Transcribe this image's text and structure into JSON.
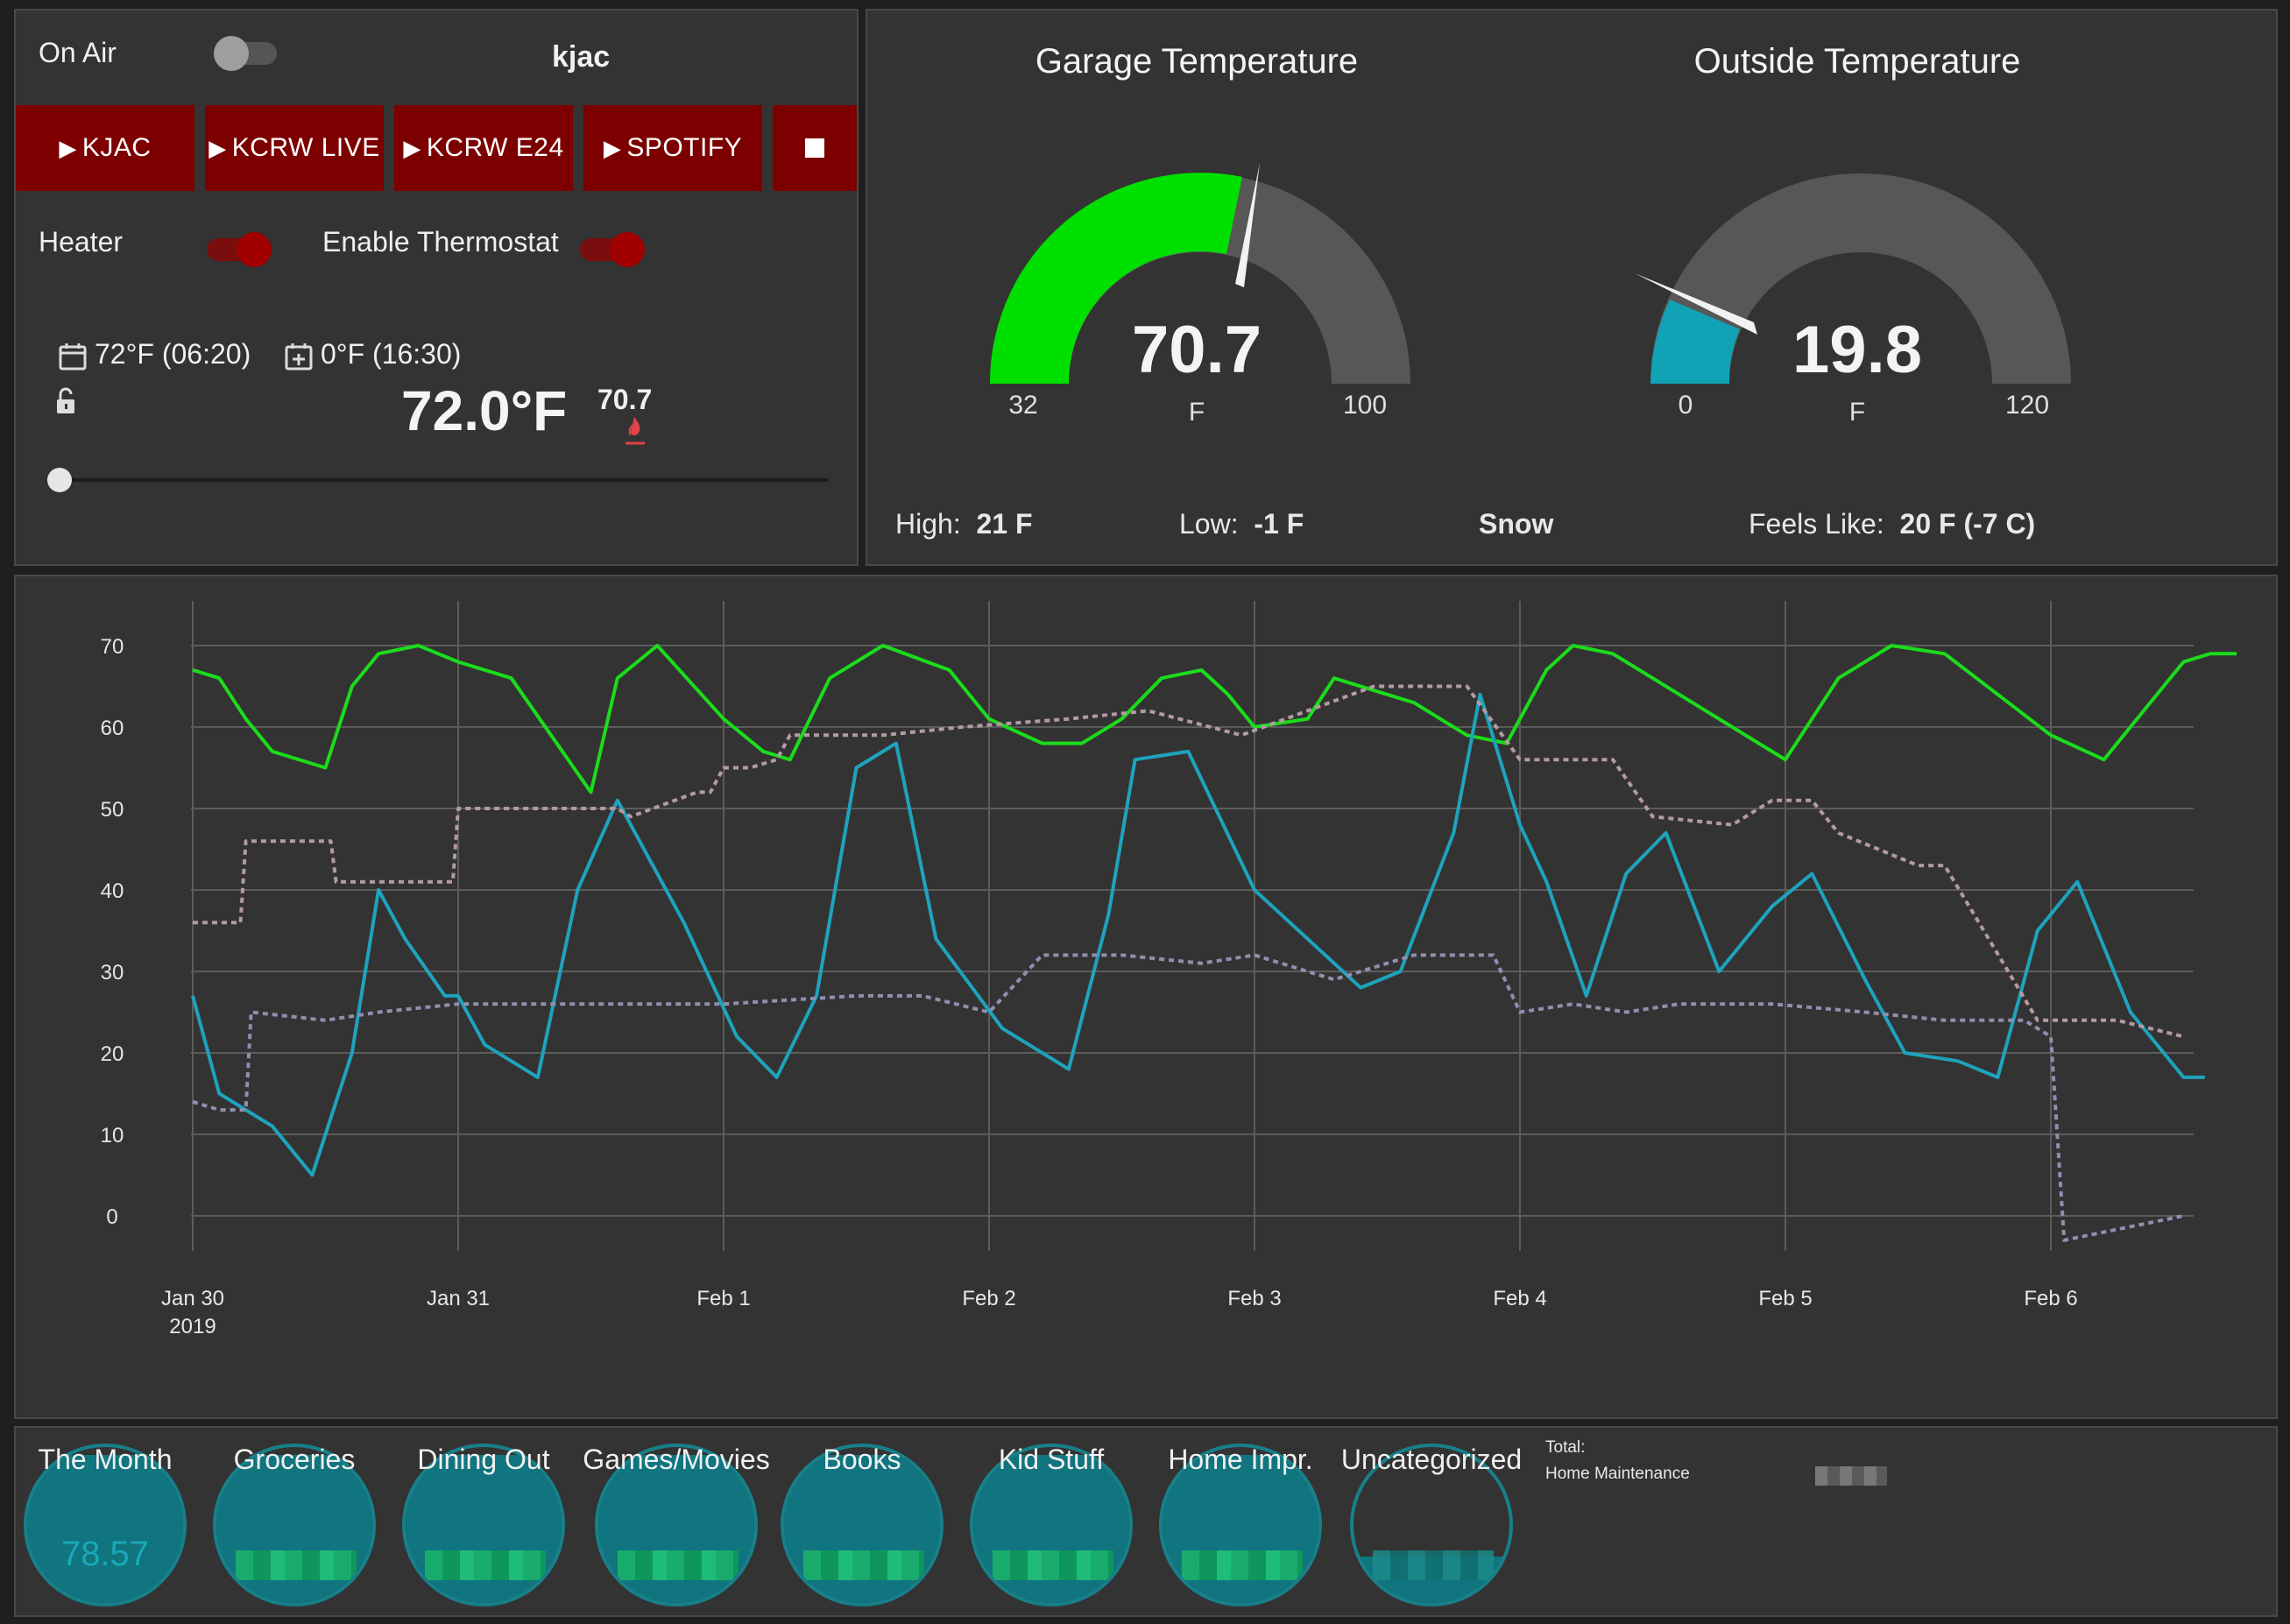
{
  "radio": {
    "on_air_label": "On Air",
    "station": "kjac",
    "buttons": [
      {
        "label": "KJAC"
      },
      {
        "label": "KCRW LIVE"
      },
      {
        "label": "KCRW E24"
      },
      {
        "label": "SPOTIFY"
      }
    ],
    "stop_icon": "stop-icon",
    "play_icon": "play-icon"
  },
  "heater": {
    "heater_label": "Heater",
    "thermostat_label": "Enable Thermostat",
    "schedule_1": "72°F (06:20)",
    "schedule_2": "0°F (16:30)",
    "setpoint": "72.0°F",
    "current": "70.7",
    "icons": [
      "calendar-icon",
      "calendar-plus-icon",
      "unlock-icon",
      "flame-icon"
    ]
  },
  "colors": {
    "garage": "#00e000",
    "outside": "#1aa1b8",
    "button": "#7d0000",
    "toggle_on": "#a00000"
  },
  "garage_gauge": {
    "title": "Garage Temperature",
    "value": "70.7",
    "unit": "F",
    "min": "32",
    "max": "100"
  },
  "outside_gauge": {
    "title": "Outside Temperature",
    "value": "19.8",
    "unit": "F",
    "min": "0",
    "max": "120"
  },
  "weather": {
    "high_label": "High:",
    "high": "21 F",
    "low_label": "Low:",
    "low": "-1 F",
    "condition": "Snow",
    "feels_label": "Feels Like:",
    "feels": "20 F (-7 C)"
  },
  "chart_data": {
    "type": "line",
    "ylim": [
      -5,
      75
    ],
    "yticks": [
      "0",
      "10",
      "20",
      "30",
      "40",
      "50",
      "60",
      "70"
    ],
    "xticks": [
      "Jan 30",
      "Jan 31",
      "Feb 1",
      "Feb 2",
      "Feb 3",
      "Feb 4",
      "Feb 5",
      "Feb 6"
    ],
    "xtick_sub": "2019",
    "grid": true,
    "series": [
      {
        "style": "solid",
        "color": "#1bdc1b",
        "x": [
          0,
          0.1,
          0.2,
          0.3,
          0.5,
          0.6,
          0.7,
          0.85,
          1.0,
          1.2,
          1.35,
          1.5,
          1.6,
          1.75,
          2.0,
          2.15,
          2.25,
          2.4,
          2.6,
          2.85,
          3.0,
          3.2,
          3.35,
          3.5,
          3.65,
          3.8,
          3.9,
          4.0,
          4.2,
          4.3,
          4.5,
          4.6,
          4.8,
          4.95,
          5.1,
          5.2,
          5.35,
          5.6,
          5.85,
          6.0,
          6.2,
          6.4,
          6.6,
          6.8,
          7.0,
          7.2,
          7.35,
          7.5,
          7.6,
          7.7
        ],
        "y": [
          67,
          66,
          61,
          57,
          55,
          65,
          69,
          70,
          68,
          66,
          59,
          52,
          66,
          70,
          61,
          57,
          56,
          66,
          70,
          67,
          61,
          58,
          58,
          61,
          66,
          67,
          64,
          60,
          61,
          66,
          64,
          63,
          59,
          58,
          67,
          70,
          69,
          64,
          59,
          56,
          66,
          70,
          69,
          64,
          59,
          56,
          62,
          68,
          69,
          69
        ]
      },
      {
        "style": "solid",
        "color": "#1ea3bd",
        "x": [
          0,
          0.1,
          0.3,
          0.45,
          0.6,
          0.7,
          0.8,
          0.95,
          1.0,
          1.1,
          1.3,
          1.45,
          1.6,
          1.85,
          2.05,
          2.2,
          2.35,
          2.5,
          2.65,
          2.8,
          3.05,
          3.3,
          3.45,
          3.55,
          3.75,
          4.0,
          4.2,
          4.4,
          4.55,
          4.75,
          4.85,
          5.0,
          5.1,
          5.25,
          5.4,
          5.55,
          5.75,
          5.95,
          6.1,
          6.3,
          6.45,
          6.65,
          6.8,
          6.95,
          7.1,
          7.3,
          7.5,
          7.58
        ],
        "y": [
          27,
          15,
          11,
          5,
          20,
          40,
          34,
          27,
          27,
          21,
          17,
          40,
          51,
          36,
          22,
          17,
          27,
          55,
          58,
          34,
          23,
          18,
          37,
          56,
          57,
          40,
          34,
          28,
          30,
          47,
          64,
          48,
          41,
          27,
          42,
          47,
          30,
          38,
          42,
          29,
          20,
          19,
          17,
          35,
          41,
          25,
          17,
          17
        ]
      },
      {
        "style": "dashed",
        "color": "#b49aa4",
        "x": [
          0,
          0.18,
          0.2,
          0.52,
          0.54,
          0.98,
          1.0,
          1.6,
          1.65,
          1.9,
          1.95,
          2.0,
          2.1,
          2.2,
          2.25,
          2.55,
          2.6,
          2.9,
          3.3,
          3.6,
          3.95,
          4.45,
          4.6,
          4.8,
          5.0,
          5.05,
          5.35,
          5.5,
          5.8,
          5.95,
          6.1,
          6.2,
          6.5,
          6.6,
          6.95,
          7.0,
          7.1,
          7.25,
          7.5
        ],
        "y": [
          36,
          36,
          46,
          46,
          41,
          41,
          50,
          50,
          49,
          52,
          52,
          55,
          55,
          56,
          59,
          59,
          59,
          60,
          61,
          62,
          59,
          65,
          65,
          65,
          56,
          56,
          56,
          49,
          48,
          51,
          51,
          47,
          43,
          43,
          24,
          24,
          24,
          24,
          22
        ]
      },
      {
        "style": "dashed",
        "color": "#8f8fb0",
        "x": [
          0,
          0.1,
          0.2,
          0.22,
          0.5,
          0.7,
          1.0,
          1.5,
          2.0,
          2.5,
          2.75,
          3.0,
          3.2,
          3.5,
          3.8,
          4.0,
          4.3,
          4.6,
          4.9,
          5.0,
          5.2,
          5.4,
          5.6,
          5.95,
          6.3,
          6.6,
          6.9,
          7.0,
          7.05,
          7.2,
          7.5
        ],
        "y": [
          14,
          13,
          13,
          25,
          24,
          25,
          26,
          26,
          26,
          27,
          27,
          25,
          32,
          32,
          31,
          32,
          29,
          32,
          32,
          25,
          26,
          25,
          26,
          26,
          25,
          24,
          24,
          22,
          -3,
          -2,
          0
        ]
      }
    ]
  },
  "budget": {
    "items": [
      {
        "label": "The Month",
        "value": "78.57",
        "fill": 0.95
      },
      {
        "label": "Groceries",
        "fill": 0.95
      },
      {
        "label": "Dining Out",
        "fill": 0.95
      },
      {
        "label": "Games/Movies",
        "fill": 0.95
      },
      {
        "label": "Books",
        "fill": 0.95
      },
      {
        "label": "Kid Stuff",
        "fill": 0.95
      },
      {
        "label": "Home Impr.",
        "fill": 0.95
      },
      {
        "label": "Uncategorized",
        "fill": 0.3
      }
    ],
    "total_label": "Total:",
    "maintenance_label": "Home Maintenance"
  }
}
